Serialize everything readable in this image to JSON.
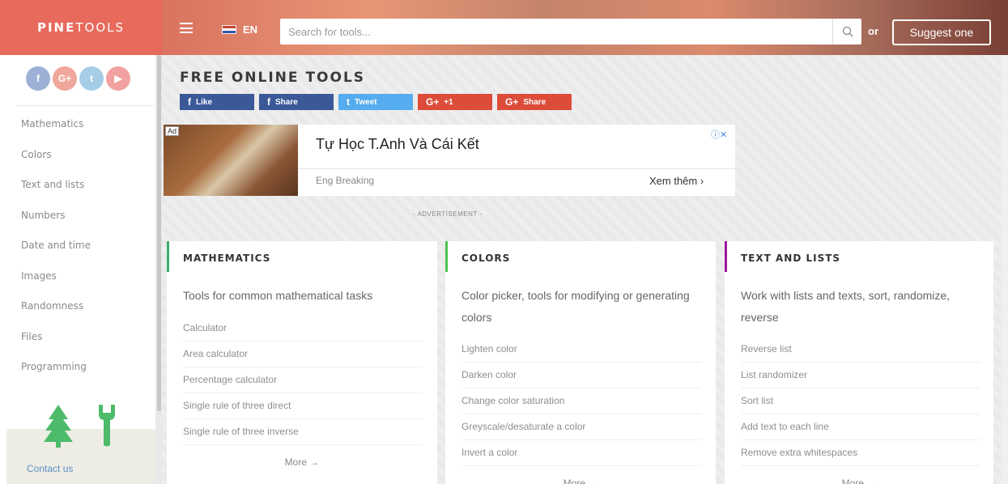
{
  "header": {
    "logo_bold": "PINE",
    "logo_thin": "TOOLS",
    "language": "EN",
    "search_placeholder": "Search for tools...",
    "or_text": "or",
    "suggest_label": "Suggest one"
  },
  "sidebar": {
    "social": [
      {
        "icon": "facebook-icon",
        "glyph": "f"
      },
      {
        "icon": "google-plus-icon",
        "glyph": "G+"
      },
      {
        "icon": "twitter-icon",
        "glyph": "t"
      },
      {
        "icon": "youtube-icon",
        "glyph": "▶"
      }
    ],
    "items": [
      {
        "label": "Mathematics"
      },
      {
        "label": "Colors"
      },
      {
        "label": "Text and lists"
      },
      {
        "label": "Numbers"
      },
      {
        "label": "Date and time"
      },
      {
        "label": "Images"
      },
      {
        "label": "Randomness"
      },
      {
        "label": "Files"
      },
      {
        "label": "Programming"
      }
    ],
    "contact": "Contact us"
  },
  "main": {
    "title": "FREE ONLINE TOOLS",
    "share": [
      {
        "glyph": "f",
        "label": "Like"
      },
      {
        "glyph": "f",
        "label": "Share"
      },
      {
        "glyph": "t",
        "label": "Tweet"
      },
      {
        "glyph": "G+",
        "label": "+1"
      },
      {
        "glyph": "G+",
        "label": "Share"
      }
    ],
    "ad": {
      "badge": "Ad",
      "title": "Tự Học T.Anh Và Cái Kết",
      "sub": "Eng Breaking",
      "cta": "Xem thêm ›",
      "label": "- ADVERTISEMENT -"
    },
    "cards": [
      {
        "title": "MATHEMATICS",
        "accent": "#3fae6a",
        "desc": "Tools for common mathematical tasks",
        "links": [
          "Calculator",
          "Area calculator",
          "Percentage calculator",
          "Single rule of three direct",
          "Single rule of three inverse"
        ],
        "more": "More →"
      },
      {
        "title": "COLORS",
        "accent": "#4cc34c",
        "desc": "Color picker, tools for modifying or generating colors",
        "links": [
          "Lighten color",
          "Darken color",
          "Change color saturation",
          "Greyscale/desaturate a color",
          "Invert a color"
        ],
        "more": "More →"
      },
      {
        "title": "TEXT AND LISTS",
        "accent": "#9c1b9c",
        "desc": "Work with lists and texts, sort, randomize, reverse",
        "links": [
          "Reverse list",
          "List randomizer",
          "Sort list",
          "Add text to each line",
          "Remove extra whitespaces"
        ],
        "more": "More →"
      }
    ]
  },
  "colors": {
    "brand": "#e76a5c",
    "facebook": "#3b5998",
    "twitter": "#55acee",
    "google": "#dd4b39",
    "link": "#5a8fc4"
  }
}
